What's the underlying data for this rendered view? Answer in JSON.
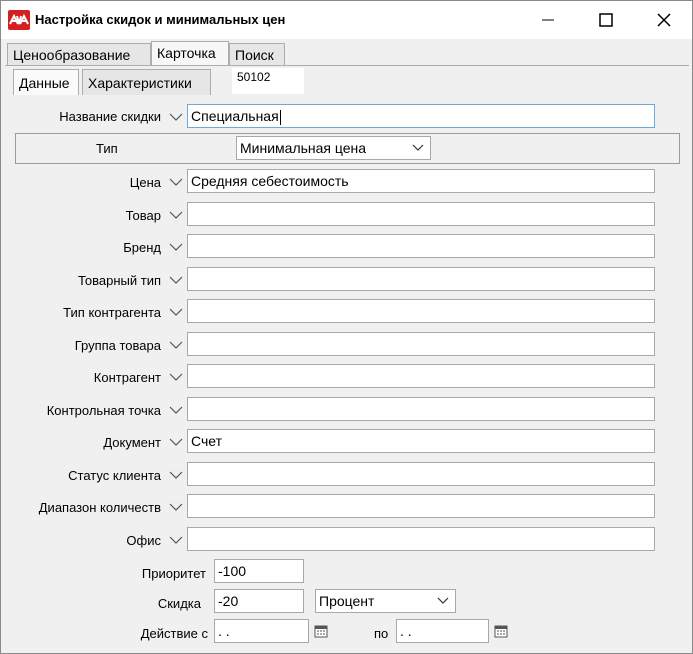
{
  "window": {
    "title": "Настройка скидок и минимальных цен",
    "app_icon": "ava-logo",
    "controls": [
      "minimize-icon",
      "maximize-icon",
      "close-icon"
    ]
  },
  "tabs": [
    {
      "label": "Ценообразование",
      "active": false
    },
    {
      "label": "Карточка",
      "active": true
    },
    {
      "label": "Поиск",
      "active": false
    }
  ],
  "subtabs": [
    {
      "label": "Данные",
      "active": true
    },
    {
      "label": "Характеристики",
      "active": false
    }
  ],
  "record_code": "50102",
  "discount_name": {
    "label": "Название скидки",
    "value": "Специальная"
  },
  "type": {
    "label": "Тип",
    "value": "Минимальная цена"
  },
  "fields": [
    {
      "label": "Цена",
      "value": "Средняя себестоимость"
    },
    {
      "label": "Товар",
      "value": ""
    },
    {
      "label": "Бренд",
      "value": ""
    },
    {
      "label": "Товарный тип",
      "value": ""
    },
    {
      "label": "Тип контрагента",
      "value": ""
    },
    {
      "label": "Группа товара",
      "value": ""
    },
    {
      "label": "Контрагент",
      "value": ""
    },
    {
      "label": "Контрольная точка",
      "value": ""
    },
    {
      "label": "Документ",
      "value": "Счет"
    },
    {
      "label": "Статус клиента",
      "value": ""
    },
    {
      "label": "Диапазон количеств",
      "value": ""
    },
    {
      "label": "Офис",
      "value": ""
    }
  ],
  "priority": {
    "label": "Приоритет",
    "value": "-100"
  },
  "discount": {
    "label": "Скидка",
    "value": "-20",
    "unit": "Процент"
  },
  "period": {
    "from_label": "Действие с",
    "from_value": " .  .",
    "to_label": "по",
    "to_value": " .  ."
  }
}
